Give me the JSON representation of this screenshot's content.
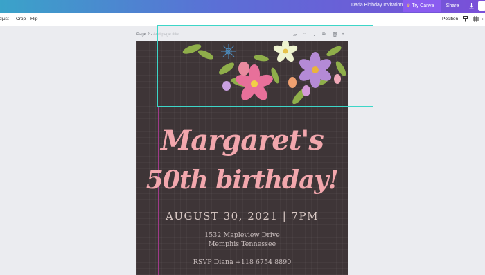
{
  "topbar": {
    "doc_title": "Darla Birthday Invitation",
    "try_pro": "Try Canva Pro",
    "share": "Share",
    "download_icon": "download-icon",
    "publish_icon": "publish-icon"
  },
  "toolbar": {
    "adjust": "djust",
    "crop": "Crop",
    "flip": "Flip",
    "position": "Position",
    "icons": [
      "paint-roller-icon",
      "grid-icon",
      "more-icon"
    ]
  },
  "page_header": {
    "label": "Page 2",
    "title_placeholder": "Add page title",
    "actions": [
      "notes-icon",
      "chevron-up-icon",
      "chevron-down-icon",
      "duplicate-icon",
      "trash-icon",
      "add-icon"
    ]
  },
  "invitation": {
    "line1": "Margaret's",
    "line2": "50th birthday!",
    "date": "AUGUST 30, 2021 | 7PM",
    "address1": "1532 Mapleview Drive",
    "address2": "Memphis Tennessee",
    "rsvp": "RSVP Diana +118 6754 8890",
    "colors": {
      "background": "#3e3537",
      "heading": "#f2a7ad",
      "body_text": "#d9c9c5"
    }
  }
}
